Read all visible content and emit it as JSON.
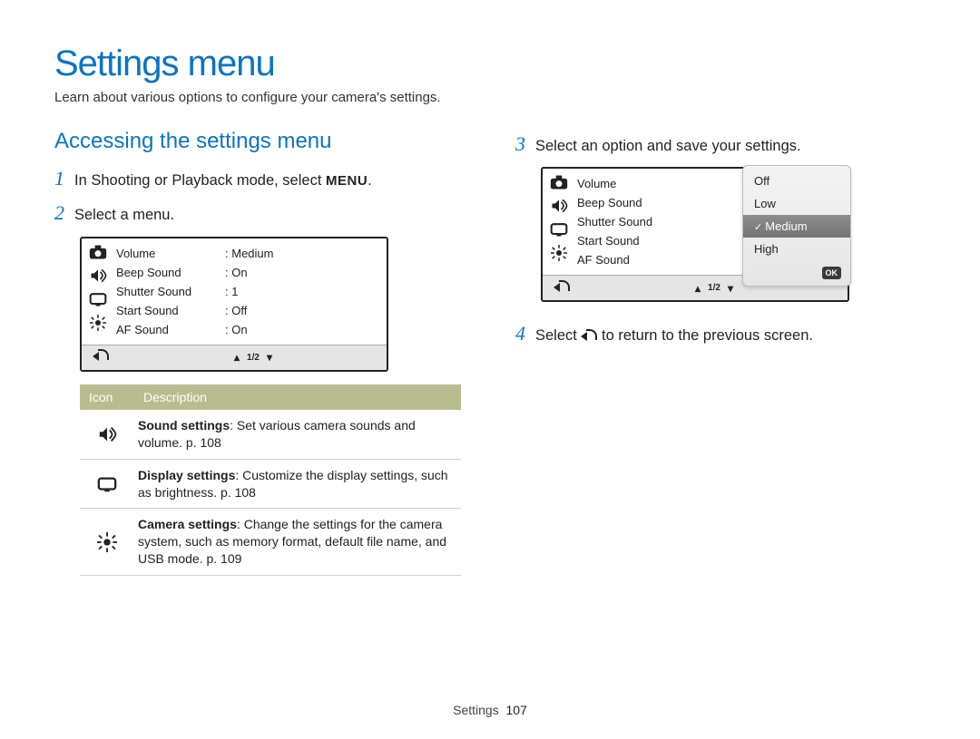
{
  "page": {
    "title": "Settings menu",
    "description": "Learn about various options to configure your camera's settings.",
    "footer_section": "Settings",
    "footer_page": "107"
  },
  "left": {
    "section_title": "Accessing the settings menu",
    "step1_num": "1",
    "step1_pre": "In Shooting or Playback mode, select ",
    "step1_menu": "MENU",
    "step1_post": ".",
    "step2_num": "2",
    "step2_text": "Select a menu."
  },
  "cam1": {
    "rows": [
      {
        "label": "Volume",
        "value": "Medium"
      },
      {
        "label": "Beep Sound",
        "value": "On"
      },
      {
        "label": "Shutter Sound",
        "value": "1"
      },
      {
        "label": "Start Sound",
        "value": "Off"
      },
      {
        "label": "AF Sound",
        "value": "On"
      }
    ],
    "page": "1/2"
  },
  "table": {
    "head_icon": "Icon",
    "head_desc": "Description",
    "rows": [
      {
        "bold": "Sound settings",
        "rest": ": Set various camera sounds and volume. p. 108"
      },
      {
        "bold": "Display settings",
        "rest": ": Customize the display settings, such as brightness. p. 108"
      },
      {
        "bold": "Camera settings",
        "rest": ": Change the settings for the camera system, such as memory format, default file name, and USB mode. p. 109"
      }
    ]
  },
  "right": {
    "step3_num": "3",
    "step3_text": "Select an option and save your settings.",
    "step4_num": "4",
    "step4_pre": "Select ",
    "step4_post": " to return to the previous screen."
  },
  "cam2": {
    "rows": [
      {
        "label": "Volume"
      },
      {
        "label": "Beep Sound"
      },
      {
        "label": "Shutter Sound"
      },
      {
        "label": "Start Sound"
      },
      {
        "label": "AF Sound"
      }
    ],
    "page": "1/2",
    "options": [
      "Off",
      "Low",
      "Medium",
      "High"
    ],
    "selected_index": 2,
    "ok": "OK"
  }
}
